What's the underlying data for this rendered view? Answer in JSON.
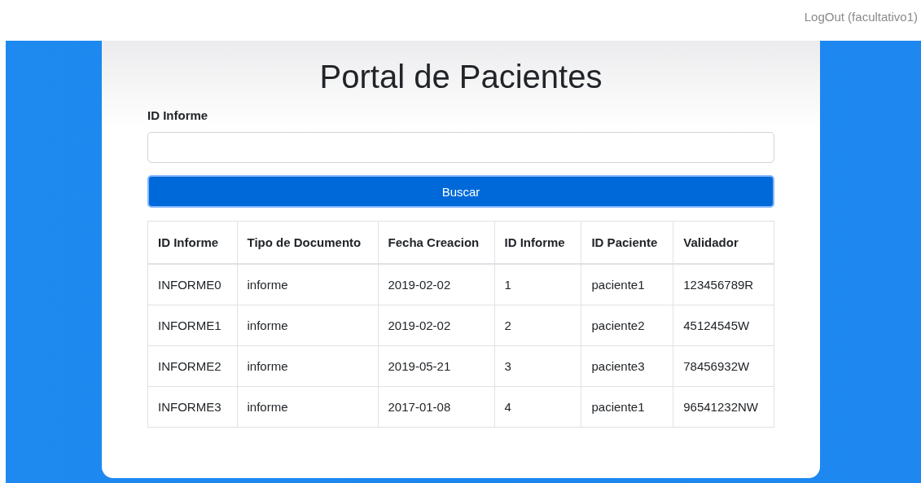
{
  "header": {
    "logout_link": "LogOut (facultativo1)"
  },
  "card": {
    "title": "Portal de Pacientes",
    "search": {
      "label": "ID Informe",
      "button": "Buscar"
    },
    "table": {
      "columns": [
        "ID Informe",
        "Tipo de Documento",
        "Fecha Creacion",
        "ID Informe",
        "ID Paciente",
        "Validador"
      ],
      "rows": [
        [
          "INFORME0",
          "informe",
          "2019-02-02",
          "1",
          "paciente1",
          "123456789R"
        ],
        [
          "INFORME1",
          "informe",
          "2019-02-02",
          "2",
          "paciente2",
          "45124545W"
        ],
        [
          "INFORME2",
          "informe",
          "2019-05-21",
          "3",
          "paciente3",
          "78456932W"
        ],
        [
          "INFORME3",
          "informe",
          "2017-01-08",
          "4",
          "paciente1",
          "96541232NW"
        ]
      ]
    }
  }
}
